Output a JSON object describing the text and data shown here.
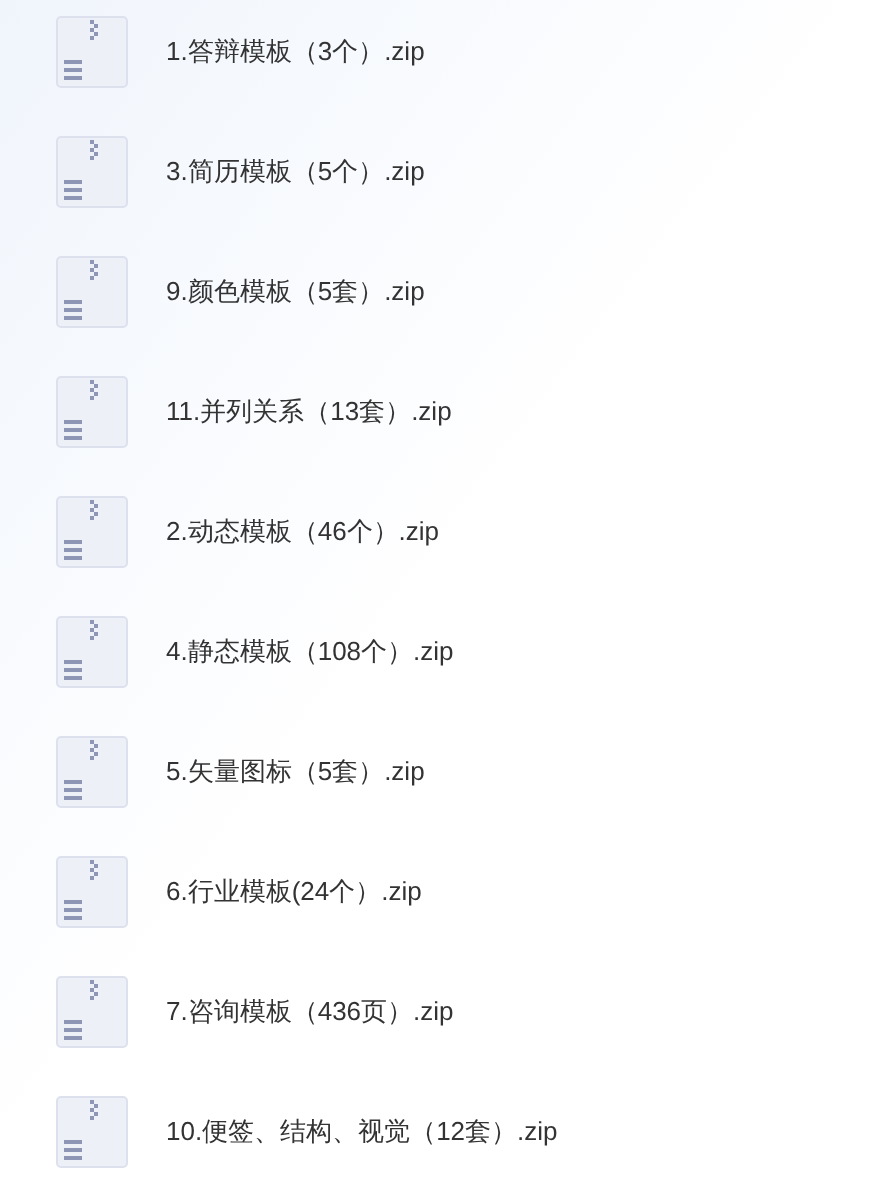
{
  "files": [
    {
      "name": "1.答辩模板（3个）.zip"
    },
    {
      "name": "3.简历模板（5个）.zip"
    },
    {
      "name": "9.颜色模板（5套）.zip"
    },
    {
      "name": "11.并列关系（13套）.zip"
    },
    {
      "name": "2.动态模板（46个）.zip"
    },
    {
      "name": "4.静态模板（108个）.zip"
    },
    {
      "name": "5.矢量图标（5套）.zip"
    },
    {
      "name": "6.行业模板(24个）.zip"
    },
    {
      "name": "7.咨询模板（436页）.zip"
    },
    {
      "name": "10.便签、结构、视觉（12套）.zip"
    }
  ]
}
